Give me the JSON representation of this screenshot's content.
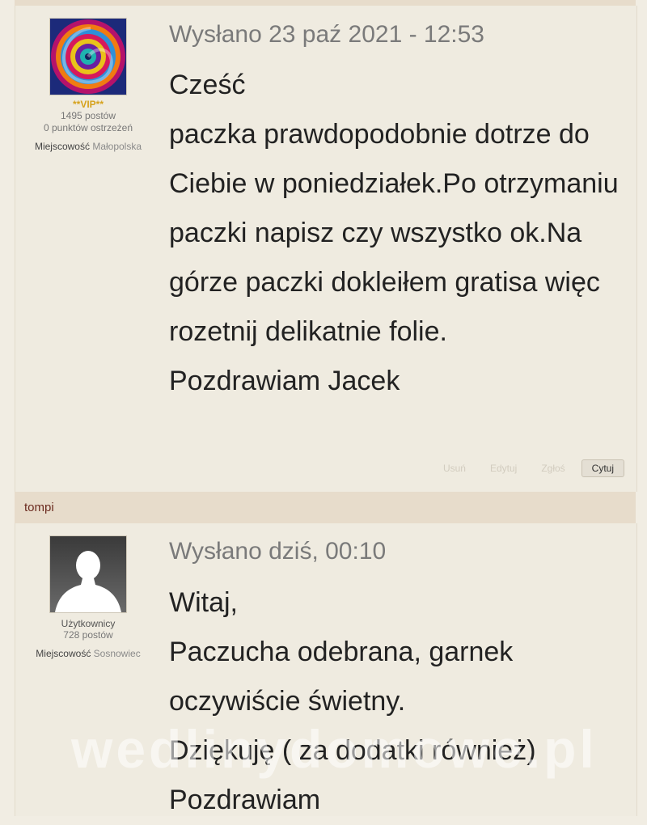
{
  "posts": [
    {
      "rank": "**VIP**",
      "post_count": "1495 postów",
      "warnings": "0 punktów ostrzeżeń",
      "location_label": "Miejscowość",
      "location_value": "Małopolska",
      "date": "Wysłano 23 paź 2021 - 12:53",
      "body": [
        "Cześć",
        "paczka prawdopodobnie dotrze do Ciebie w poniedziałek.Po otrzymaniu paczki napisz czy wszystko ok.Na górze paczki dokleiłem gratisa więc rozetnij delikatnie folie.",
        "Pozdrawiam Jacek"
      ],
      "actions": {
        "delete": "Usuń",
        "edit": "Edytuj",
        "report": "Zgłoś",
        "quote": "Cytuj"
      }
    },
    {
      "username": "tompi",
      "rank": "Użytkownicy",
      "post_count": "728 postów",
      "location_label": "Miejscowość",
      "location_value": "Sosnowiec",
      "date": "Wysłano dziś, 00:10",
      "body": [
        "Witaj,",
        "Paczucha odebrana, garnek oczywiście świetny.",
        "Dziękuję ( za dodatki również)",
        "Pozdrawiam"
      ]
    }
  ],
  "watermark": "wedlinydomowe.pl"
}
